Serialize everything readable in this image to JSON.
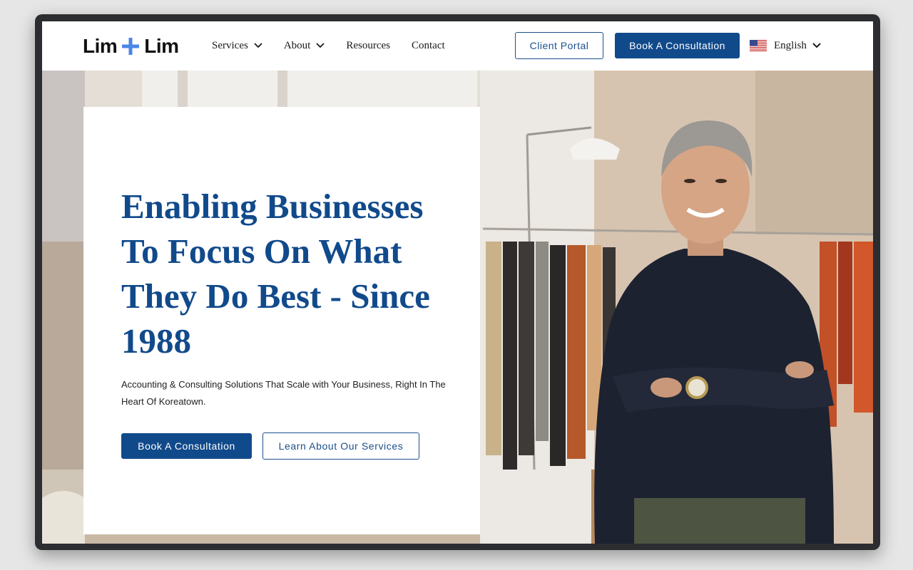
{
  "brand": {
    "logo_left": "Lim",
    "logo_right": "Lim",
    "logo_plus_color": "#4a86e8"
  },
  "nav": {
    "links": [
      {
        "label": "Services",
        "has_dropdown": true
      },
      {
        "label": "About",
        "has_dropdown": true
      },
      {
        "label": "Resources",
        "has_dropdown": false
      },
      {
        "label": "Contact",
        "has_dropdown": false
      }
    ],
    "client_portal_label": "Client Portal",
    "book_label": "Book A Consultation",
    "language": {
      "label": "English",
      "flag_icon": "us-flag-icon"
    }
  },
  "hero": {
    "headline": "Enabling Businesses To Focus On What They Do Best - Since 1988",
    "subtext": "Accounting & Consulting Solutions That Scale with Your Business, Right In The Heart Of Koreatown.",
    "primary_cta": "Book A Consultation",
    "secondary_cta": "Learn About Our Services"
  },
  "colors": {
    "brand_blue": "#114a8b",
    "accent_blue": "#4a86e8",
    "device_frame": "#2b2d30"
  }
}
